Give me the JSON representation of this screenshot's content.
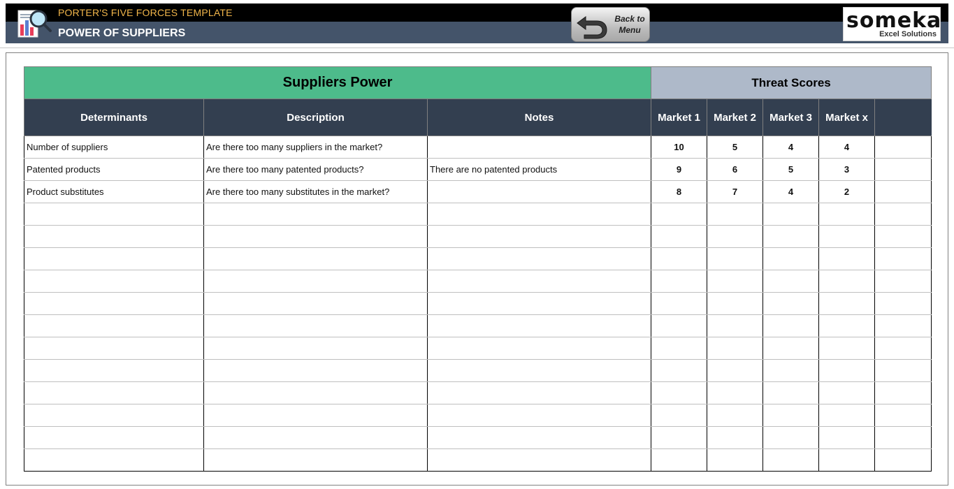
{
  "header": {
    "subtitle": "PORTER'S FIVE FORCES TEMPLATE",
    "title": "POWER OF SUPPLIERS",
    "back_button_label": "Back to\nMenu",
    "logo_brand": "someka",
    "logo_tagline": "Excel Solutions",
    "icons": {
      "app": "analytics-magnifier-icon",
      "back": "back-arrow-icon"
    }
  },
  "table": {
    "band_left": "Suppliers Power",
    "band_right": "Threat Scores",
    "columns": [
      "Determinants",
      "Description",
      "Notes",
      "Market 1",
      "Market 2",
      "Market 3",
      "Market x",
      ""
    ],
    "rows": [
      {
        "determinant": "Number of suppliers",
        "description": "Are there too many suppliers in the market?",
        "notes": "",
        "scores": [
          "10",
          "5",
          "4",
          "4",
          ""
        ]
      },
      {
        "determinant": "Patented products",
        "description": "Are there too many patented products?",
        "notes": "There are no patented products",
        "scores": [
          "9",
          "6",
          "5",
          "3",
          ""
        ]
      },
      {
        "determinant": "Product substitutes",
        "description": "Are there too many substitutes in the market?",
        "notes": "",
        "scores": [
          "8",
          "7",
          "4",
          "2",
          ""
        ]
      },
      {
        "determinant": "",
        "description": "",
        "notes": "",
        "scores": [
          "",
          "",
          "",
          "",
          ""
        ]
      },
      {
        "determinant": "",
        "description": "",
        "notes": "",
        "scores": [
          "",
          "",
          "",
          "",
          ""
        ]
      },
      {
        "determinant": "",
        "description": "",
        "notes": "",
        "scores": [
          "",
          "",
          "",
          "",
          ""
        ]
      },
      {
        "determinant": "",
        "description": "",
        "notes": "",
        "scores": [
          "",
          "",
          "",
          "",
          ""
        ]
      },
      {
        "determinant": "",
        "description": "",
        "notes": "",
        "scores": [
          "",
          "",
          "",
          "",
          ""
        ]
      },
      {
        "determinant": "",
        "description": "",
        "notes": "",
        "scores": [
          "",
          "",
          "",
          "",
          ""
        ]
      },
      {
        "determinant": "",
        "description": "",
        "notes": "",
        "scores": [
          "",
          "",
          "",
          "",
          ""
        ]
      },
      {
        "determinant": "",
        "description": "",
        "notes": "",
        "scores": [
          "",
          "",
          "",
          "",
          ""
        ]
      },
      {
        "determinant": "",
        "description": "",
        "notes": "",
        "scores": [
          "",
          "",
          "",
          "",
          ""
        ]
      },
      {
        "determinant": "",
        "description": "",
        "notes": "",
        "scores": [
          "",
          "",
          "",
          "",
          ""
        ]
      },
      {
        "determinant": "",
        "description": "",
        "notes": "",
        "scores": [
          "",
          "",
          "",
          "",
          ""
        ]
      },
      {
        "determinant": "",
        "description": "",
        "notes": "",
        "scores": [
          "",
          "",
          "",
          "",
          ""
        ]
      }
    ]
  },
  "colors": {
    "header_dark": "#000000",
    "header_slate": "#44546a",
    "subtitle_gold": "#f2b64a",
    "band_green": "#4dbb8b",
    "band_grey": "#aeb9c9",
    "column_header": "#333f50"
  }
}
